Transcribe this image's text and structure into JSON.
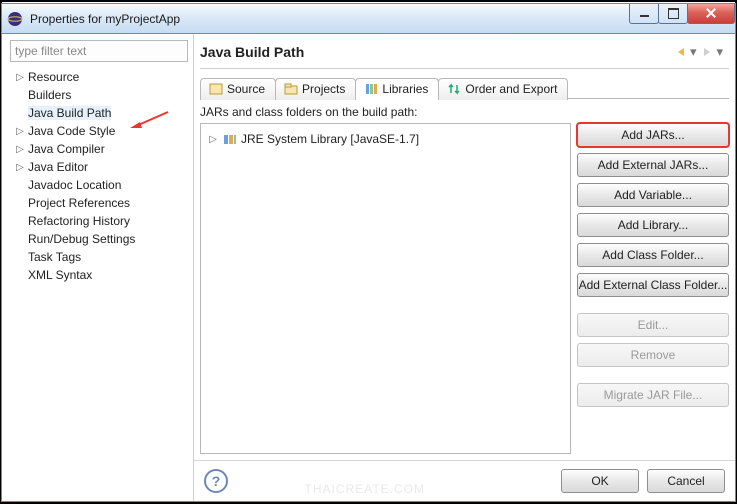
{
  "window": {
    "title": "Properties for myProjectApp"
  },
  "filter": {
    "placeholder": "type filter text"
  },
  "tree": [
    {
      "label": "Resource",
      "expandable": true,
      "selected": false
    },
    {
      "label": "Builders",
      "expandable": false,
      "selected": false
    },
    {
      "label": "Java Build Path",
      "expandable": false,
      "selected": true
    },
    {
      "label": "Java Code Style",
      "expandable": true,
      "selected": false
    },
    {
      "label": "Java Compiler",
      "expandable": true,
      "selected": false
    },
    {
      "label": "Java Editor",
      "expandable": true,
      "selected": false
    },
    {
      "label": "Javadoc Location",
      "expandable": false,
      "selected": false
    },
    {
      "label": "Project References",
      "expandable": false,
      "selected": false
    },
    {
      "label": "Refactoring History",
      "expandable": false,
      "selected": false
    },
    {
      "label": "Run/Debug Settings",
      "expandable": false,
      "selected": false
    },
    {
      "label": "Task Tags",
      "expandable": false,
      "selected": false
    },
    {
      "label": "XML Syntax",
      "expandable": false,
      "selected": false
    }
  ],
  "page": {
    "heading": "Java Build Path",
    "tabs": [
      {
        "label": "Source",
        "active": false
      },
      {
        "label": "Projects",
        "active": false
      },
      {
        "label": "Libraries",
        "active": true
      },
      {
        "label": "Order and Export",
        "active": false
      }
    ],
    "subcaption": "JARs and class folders on the build path:",
    "lib_items": [
      "JRE System Library [JavaSE-1.7]"
    ],
    "buttons": {
      "add_jars": "Add JARs...",
      "add_ext_jars": "Add External JARs...",
      "add_variable": "Add Variable...",
      "add_library": "Add Library...",
      "add_class_folder": "Add Class Folder...",
      "add_ext_folder": "Add External Class Folder...",
      "edit": "Edit...",
      "remove": "Remove",
      "migrate": "Migrate JAR File..."
    }
  },
  "footer": {
    "ok": "OK",
    "cancel": "Cancel"
  },
  "colors": {
    "highlight": "#e33333"
  },
  "watermark": "THAICREATE.COM"
}
